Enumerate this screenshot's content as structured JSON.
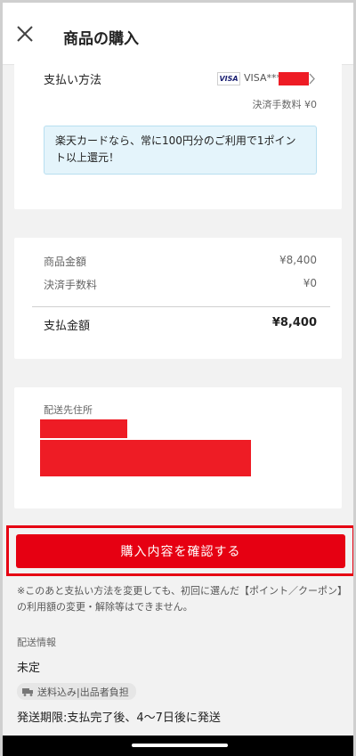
{
  "header": {
    "title": "商品の購入"
  },
  "payment": {
    "label": "支払い方法",
    "card_badge": "VISA",
    "card_text": "VISA***",
    "fee_note": "決済手数料 ¥0",
    "info": "楽天カードなら、常に100円分のご利用で1ポイント以上還元！"
  },
  "summary": {
    "rows": [
      {
        "label": "商品金額",
        "value": "¥8,400"
      },
      {
        "label": "決済手数料",
        "value": "¥0"
      }
    ],
    "total_label": "支払金額",
    "total_value": "¥8,400"
  },
  "address": {
    "label": "配送先住所"
  },
  "confirm_button": {
    "label": "購入内容を確認する"
  },
  "notice": "※このあと支払い方法を変更しても、初回に選んだ【ポイント／クーポン】の利用額の変更・解除等はできません。",
  "shipping": {
    "label": "配送情報",
    "status": "未定",
    "badge": "送料込み|出品者負担",
    "period": "発送期限:支払完了後、4〜7日後に発送"
  },
  "colors": {
    "accent": "#e60012",
    "info_bg": "#e4f4fb",
    "redaction": "#ee1c25"
  },
  "icons": {
    "close": "close-icon",
    "chevron": "chevron-right-icon",
    "truck": "truck-icon"
  }
}
